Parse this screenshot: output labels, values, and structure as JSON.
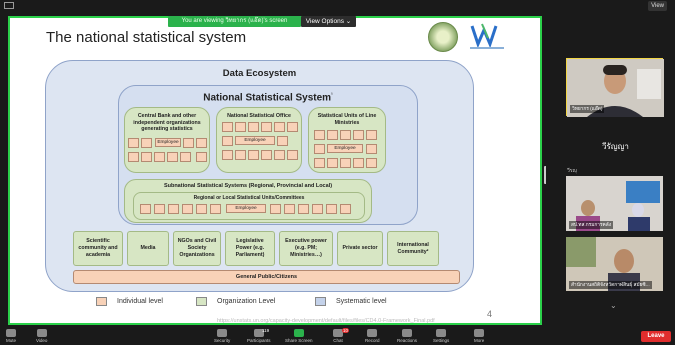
{
  "window": {
    "view_label": "View"
  },
  "share": {
    "banner": "You are viewing วิทยากร (แอ๊ด)'s screen",
    "view_options": "View Options ⌄"
  },
  "slide": {
    "title": "The national statistical system",
    "ecosystem_title": "Data Ecosystem",
    "nss_title": "National Statistical System",
    "nss_superscript": "¹",
    "cluster_central": "Central Bank and other independent organizations generating statistics",
    "cluster_nso": "National Statistical Office",
    "cluster_line": "Statistical Units of Line Ministries",
    "employee": "Employee",
    "subnational": "Subnational Statistical Systems (Regional, Provincial and Local)",
    "regional_units": "Regional or Local Statistical Units/Committees",
    "entities": [
      "Scientific community and academia",
      "Media",
      "NGOs and Civil Society Organizations",
      "Legislative Power (e.g. Parliament)",
      "Executive power (e.g. PM; Ministries…)",
      "Private sector",
      "International Community²"
    ],
    "public": "General Public/Citizens",
    "legend": [
      {
        "label": "Individual level",
        "color": "#f8d2b8"
      },
      {
        "label": "Organization Level",
        "color": "#d7e6c4"
      },
      {
        "label": "Systematic level",
        "color": "#c4d2ea"
      }
    ],
    "page_number": "4",
    "url": "https://unstats.un.org/capacity-development/default/files/files/CD4.0-Framework_Final.pdf"
  },
  "participants": [
    {
      "name": "วิทยากร (แอ๊ด)"
    },
    {
      "name": "วีรัญญา"
    },
    {
      "name": "วีรญุ"
    },
    {
      "name": "สป.ทส.กรมการคลัง"
    },
    {
      "name": "สำนักงานสถิติจังหวัดกาฬสินธุ์ สมัยซิ..."
    }
  ],
  "toolbar": {
    "items": [
      "Mute",
      "Video",
      "Security",
      "Participants",
      "Share Screen",
      "Chat",
      "Record",
      "Reactions",
      "Settings",
      "More"
    ],
    "participants_count": "119",
    "chat_badge": "10",
    "leave": "Leave"
  },
  "colors": {
    "share_border": "#2bd14a",
    "leave": "#e02d2d"
  }
}
